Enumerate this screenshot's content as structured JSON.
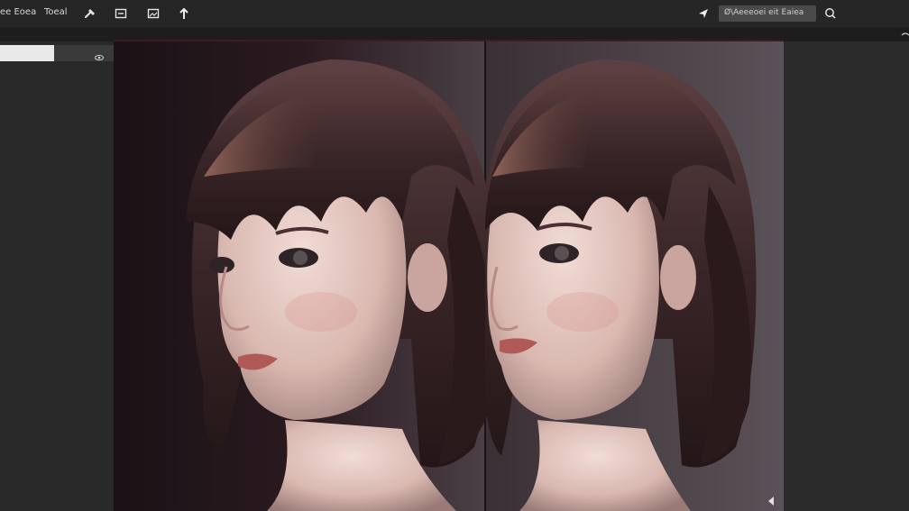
{
  "menu": {
    "items": [
      {
        "label": "ee Eoea"
      },
      {
        "label": "Toeal"
      }
    ]
  },
  "search": {
    "value": "Ø\\Aeeeoei eit Eaiea"
  },
  "layers": {
    "first_layer_label": ""
  },
  "icons": {
    "toolbar": [
      "hammer-icon",
      "frame-icon",
      "image-icon",
      "arrow-up-icon"
    ],
    "right": [
      "pointer-icon",
      "search-icon"
    ],
    "layer": "eye-icon"
  },
  "colors": {
    "topbar": "#262626",
    "panel": "#292929",
    "search_bg": "#4a4a4a",
    "accent_line": "#5a1a22"
  }
}
